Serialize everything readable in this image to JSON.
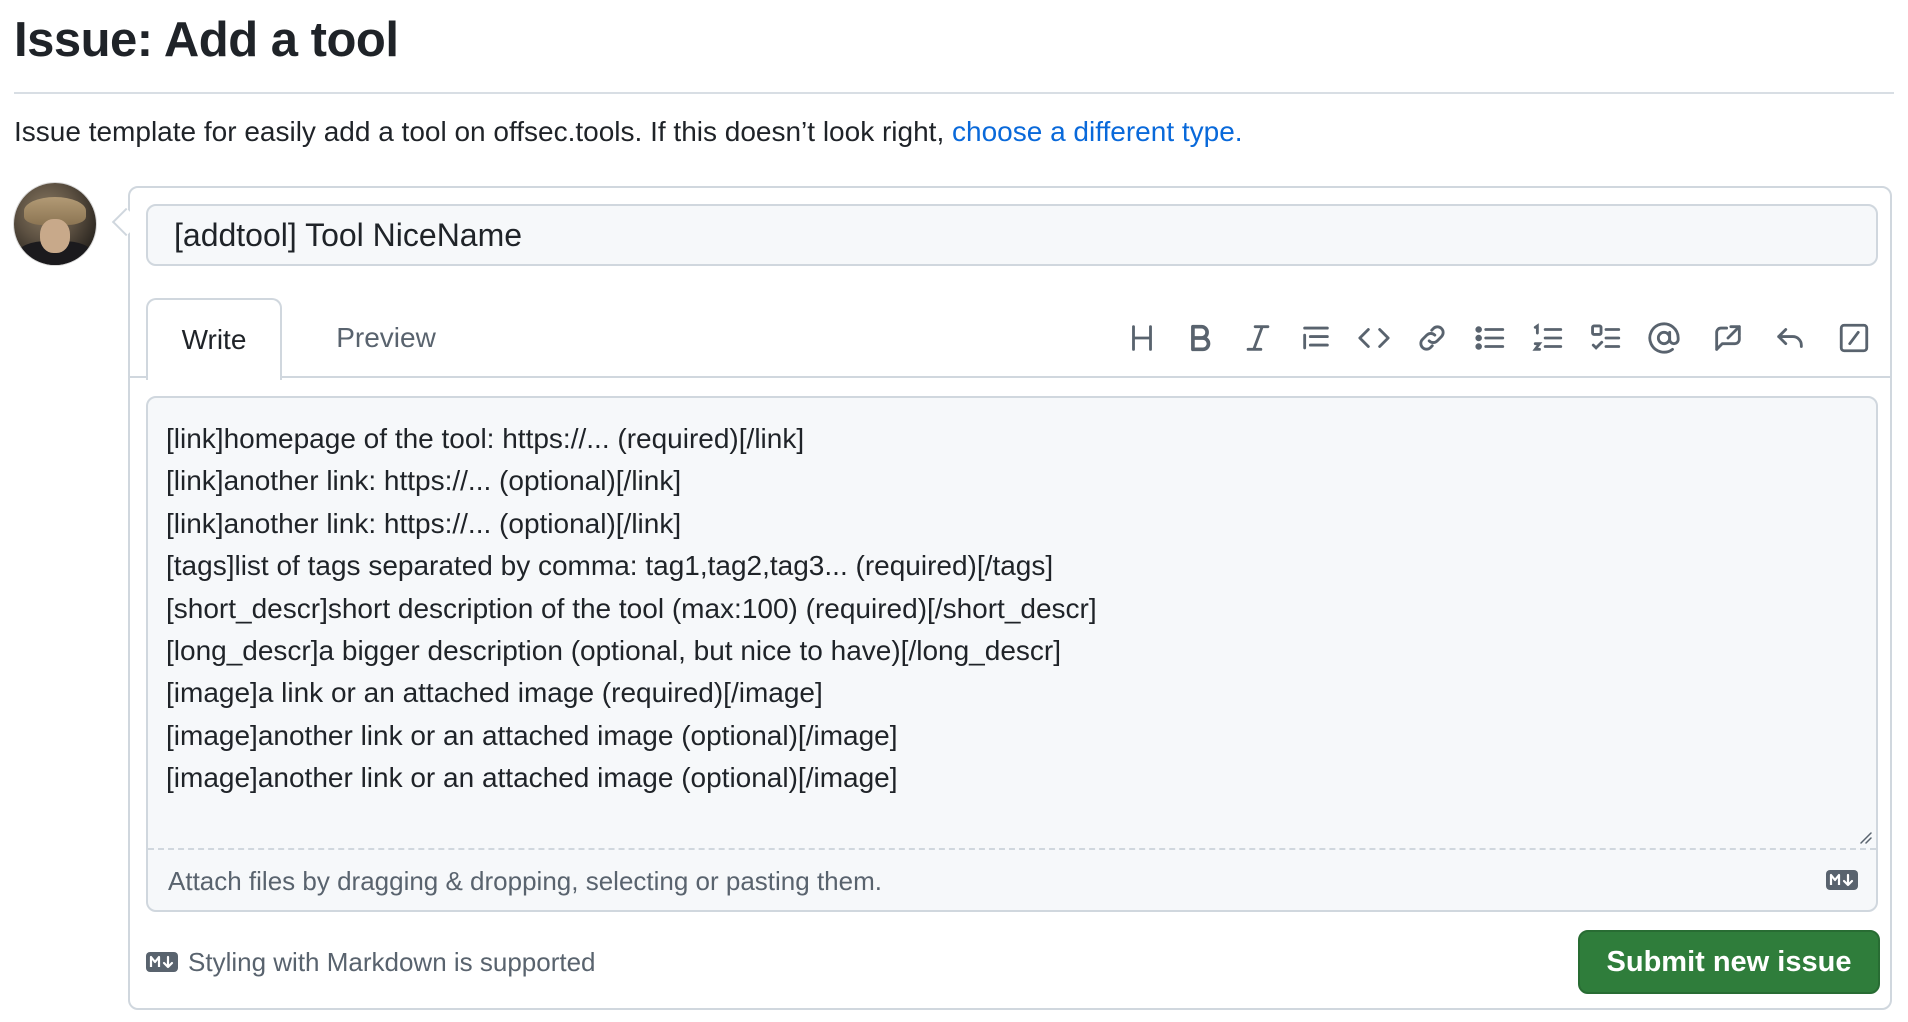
{
  "page": {
    "title": "Issue: Add a tool",
    "template_description": "Issue template for easily add a tool on offsec.tools. If this doesn’t look right,",
    "choose_link": "choose a different type."
  },
  "issue_form": {
    "title_value": "[addtool] Tool NiceName",
    "tabs": {
      "write": "Write",
      "preview": "Preview"
    },
    "toolbar_icons": [
      "heading-icon",
      "bold-icon",
      "italic-icon",
      "quote-icon",
      "code-icon",
      "link-icon",
      "unordered-list-icon",
      "ordered-list-icon",
      "task-list-icon",
      "mention-icon",
      "reference-icon",
      "undo-icon",
      "slash-commands-icon"
    ],
    "body_value": "[link]homepage of the tool: https://... (required)[/link]\n[link]another link: https://... (optional)[/link]\n[link]another link: https://... (optional)[/link]\n[tags]list of tags separated by comma: tag1,tag2,tag3... (required)[/tags]\n[short_descr]short description of the tool (max:100) (required)[/short_descr]\n[long_descr]a bigger description (optional, but nice to have)[/long_descr]\n[image]a link or an attached image (required)[/image]\n[image]another link or an attached image (optional)[/image]\n[image]another link or an attached image (optional)[/image]",
    "attach_hint": "Attach files by dragging & dropping, selecting or pasting them.",
    "markdown_note": "Styling with Markdown is supported",
    "submit_label": "Submit new issue"
  },
  "colors": {
    "link": "#0969da",
    "submit_bg": "#2f7d3b",
    "border": "#d0d7de",
    "muted_text": "#59636e"
  }
}
